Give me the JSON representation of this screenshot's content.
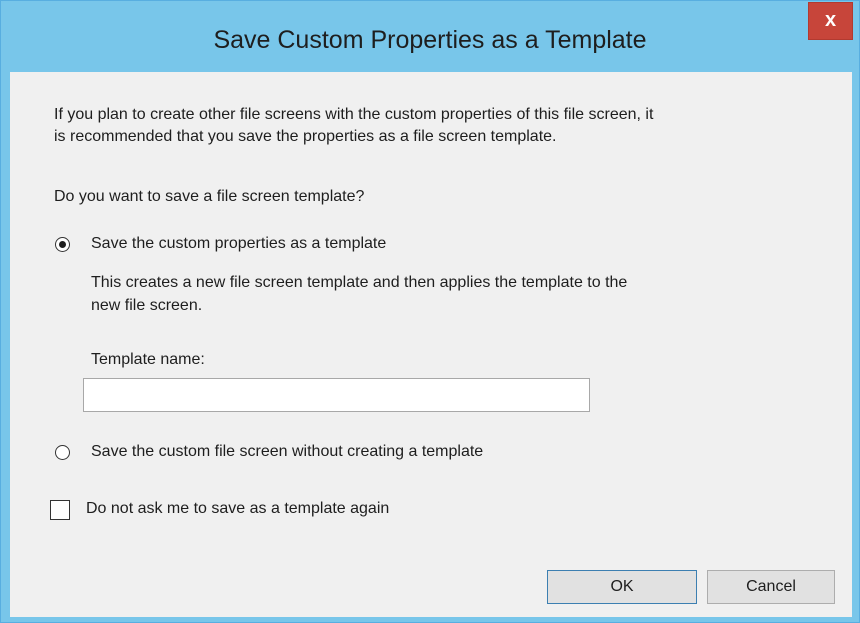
{
  "window": {
    "title": "Save Custom Properties as a Template",
    "close_glyph": "x"
  },
  "intro": {
    "line1": "If you plan to create other file screens with the custom properties of this file screen, it",
    "line2": "is recommended that you save the properties as a file screen template."
  },
  "question": "Do you want to save a file screen template?",
  "options": {
    "save_template": {
      "label": "Save the custom properties as a template",
      "selected": true,
      "description_line1": "This creates a new file screen template and then applies the template to the",
      "description_line2": "new file screen."
    },
    "no_template": {
      "label": "Save the custom file screen without creating a template",
      "selected": false
    }
  },
  "template_name": {
    "label": "Template name:",
    "value": ""
  },
  "dont_ask": {
    "label": "Do not ask me to save as a template again",
    "checked": false
  },
  "buttons": {
    "ok": "OK",
    "cancel": "Cancel"
  },
  "colors": {
    "titlebar": "#78c6ea",
    "close_button": "#c7453a",
    "client_bg": "#f0f0f0"
  }
}
